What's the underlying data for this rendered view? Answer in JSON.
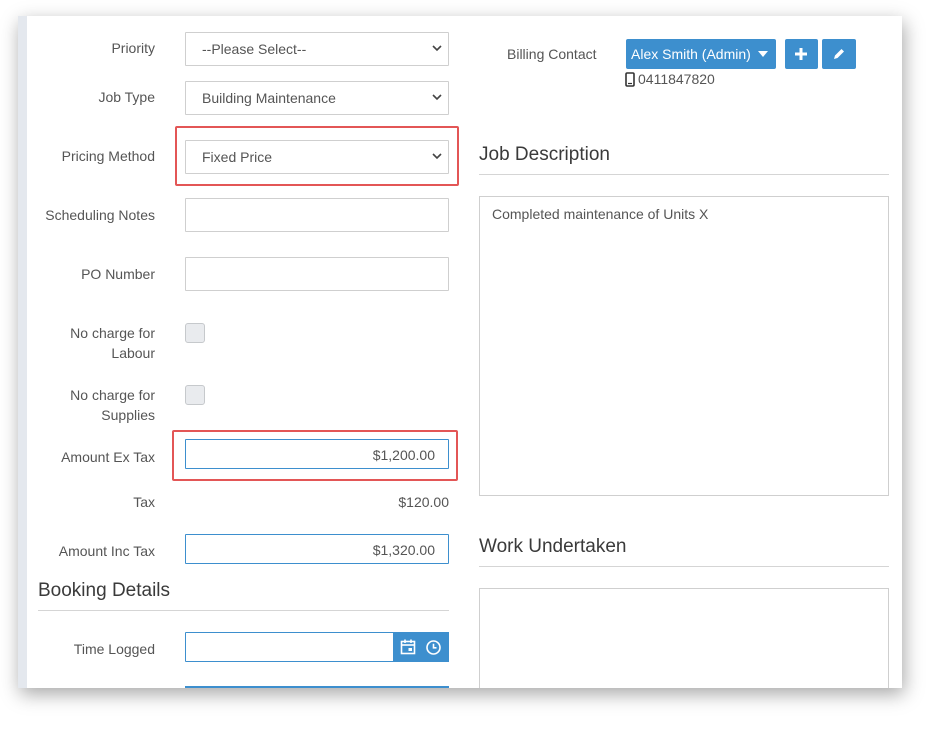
{
  "form": {
    "priority": {
      "label": "Priority",
      "value": "--Please Select--"
    },
    "job_type": {
      "label": "Job Type",
      "value": "Building Maintenance"
    },
    "pricing_method": {
      "label": "Pricing Method",
      "value": "Fixed Price"
    },
    "scheduling_notes": {
      "label": "Scheduling Notes",
      "value": ""
    },
    "po_number": {
      "label": "PO Number",
      "value": ""
    },
    "no_charge_labour": {
      "label_line1": "No charge for",
      "label_line2": "Labour",
      "checked": false
    },
    "no_charge_supplies": {
      "label_line1": "No charge for",
      "label_line2": "Supplies",
      "checked": false
    },
    "amount_ex_tax": {
      "label": "Amount Ex Tax",
      "value": "$1,200.00"
    },
    "tax": {
      "label": "Tax",
      "value": "$120.00"
    },
    "amount_inc_tax": {
      "label": "Amount Inc Tax",
      "value": "$1,320.00"
    }
  },
  "booking": {
    "title": "Booking Details",
    "time_logged": {
      "label": "Time Logged",
      "value": ""
    }
  },
  "billing": {
    "label": "Billing Contact",
    "contact": "Alex Smith (Admin)",
    "phone": "0411847820"
  },
  "job_description": {
    "title": "Job Description",
    "text": "Completed maintenance of Units X"
  },
  "work_undertaken": {
    "title": "Work Undertaken",
    "text": ""
  },
  "colors": {
    "accent": "#3d8fce",
    "highlight": "#e35656"
  },
  "icons": [
    "chevron-down-icon",
    "caret-down-icon",
    "plus-icon",
    "pencil-icon",
    "mobile-phone-icon",
    "calendar-icon",
    "clock-icon"
  ]
}
